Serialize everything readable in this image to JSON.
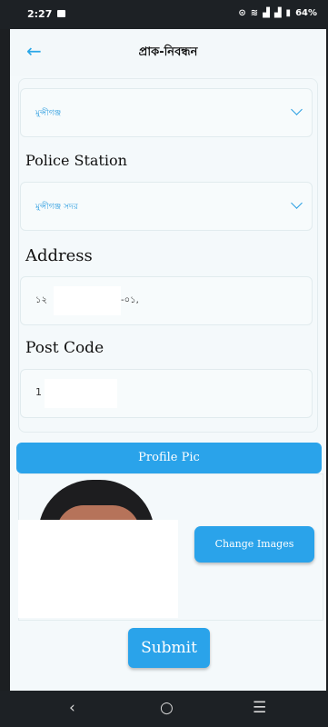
{
  "status": {
    "time": "2:27",
    "battery": "64%",
    "icons": [
      "alarm-icon",
      "wifi-icon",
      "signal-icon",
      "signal-icon",
      "battery-icon"
    ]
  },
  "header": {
    "back_icon": "←",
    "title": "প্রাক-নিবন্ধন"
  },
  "form": {
    "district_value": "মুন্সীগঞ্জ",
    "police_label": "Police Station",
    "police_value": "মুন্সীগঞ্জ সদর",
    "address_label": "Address",
    "address_value_a": "১২",
    "address_value_b": "-০১,",
    "postcode_label": "Post Code",
    "postcode_value": "1"
  },
  "profile": {
    "section_label": "Profile Pic",
    "change_images_label": "Change Images"
  },
  "submit_label": "Submit",
  "nav": {
    "back": "‹",
    "home": "○",
    "recents": "☰"
  },
  "colors": {
    "accent": "#2aa3ea",
    "background": "#f4f9fb"
  }
}
